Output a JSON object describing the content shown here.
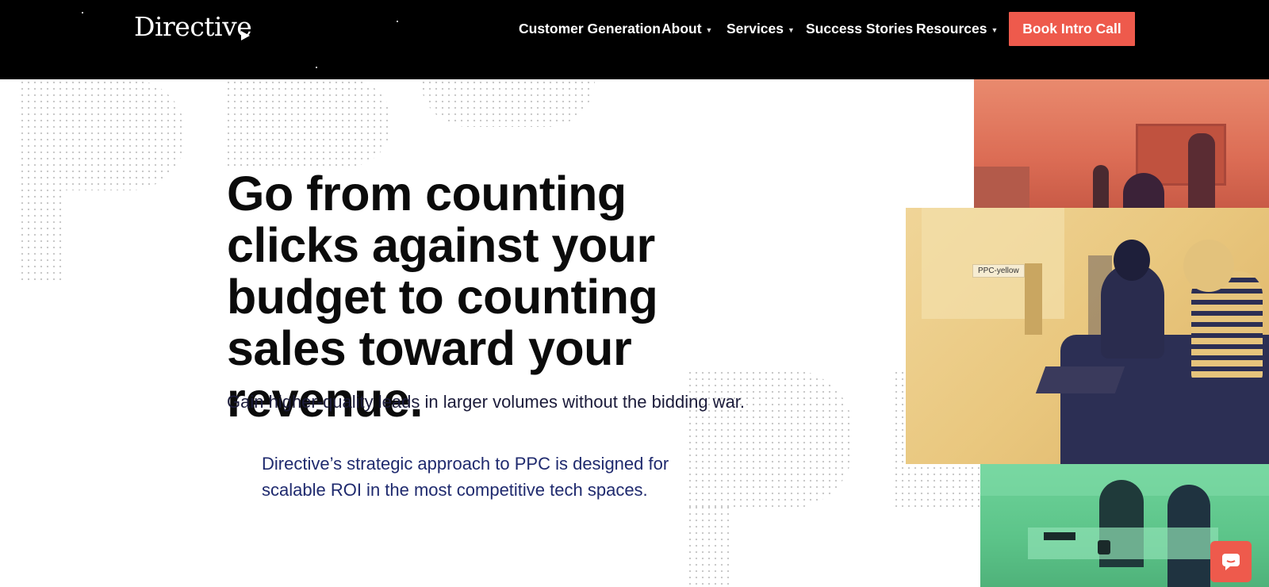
{
  "header": {
    "logo": "Directive",
    "nav": {
      "customer_generation": "Customer Generation",
      "about": "About",
      "services": "Services",
      "success_stories": "Success Stories",
      "resources": "Resources"
    },
    "cta": "Book Intro Call"
  },
  "hero": {
    "headline": "Go from counting clicks against your budget to counting sales toward your revenue.",
    "subheadline": "Gain higher-quality leads in larger volumes without the bidding war.",
    "body": "Directive’s strategic approach to PPC is designed for scalable ROI in the most competitive tech spaces."
  },
  "images": {
    "yellow_tag": "PPC-yellow"
  },
  "icons": {
    "dropdown": "chevron-down-icon",
    "chat": "chat-icon"
  },
  "colors": {
    "header_bg": "#000000",
    "accent": "#ee5a4c",
    "body_text": "#1f2a6e",
    "photo_red": "#dc6d55",
    "photo_yellow": "#e9c77e",
    "photo_green": "#5cc489"
  }
}
